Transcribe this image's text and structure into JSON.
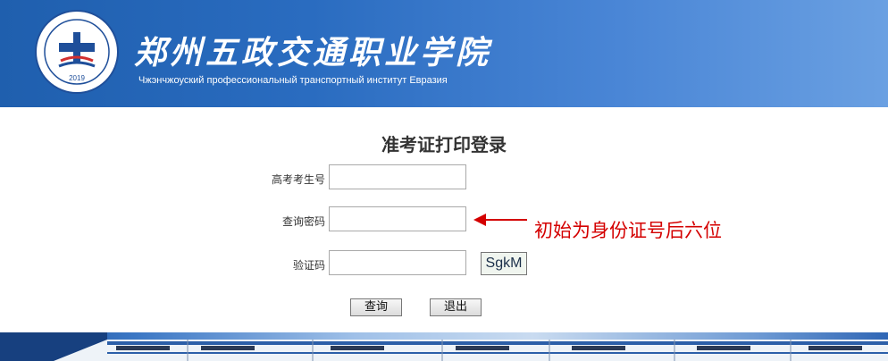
{
  "header": {
    "school_name": "郑州五政交通职业学院",
    "school_subtitle": "Чжэнчжоуский профессиональный транспортный институт Евразия",
    "logo_year": "2019",
    "logo_icon": "school-emblem-icon",
    "colors": {
      "header_start": "#1f5fae",
      "header_end": "#6aa0e2"
    }
  },
  "page_title": "准考证打印登录",
  "form": {
    "exam_number_label": "高考考生号",
    "exam_number_value": "",
    "password_label": "查询密码",
    "password_value": "",
    "captcha_label": "验证码",
    "captcha_value": "",
    "captcha_text": "SgkM"
  },
  "hint": {
    "text": "初始为身份证号后六位",
    "color": "#d40000",
    "arrow_icon": "arrow-left-icon"
  },
  "buttons": {
    "query": "查询",
    "exit": "退出"
  },
  "footer": {
    "banner_icon": "high-speed-train-icon"
  }
}
